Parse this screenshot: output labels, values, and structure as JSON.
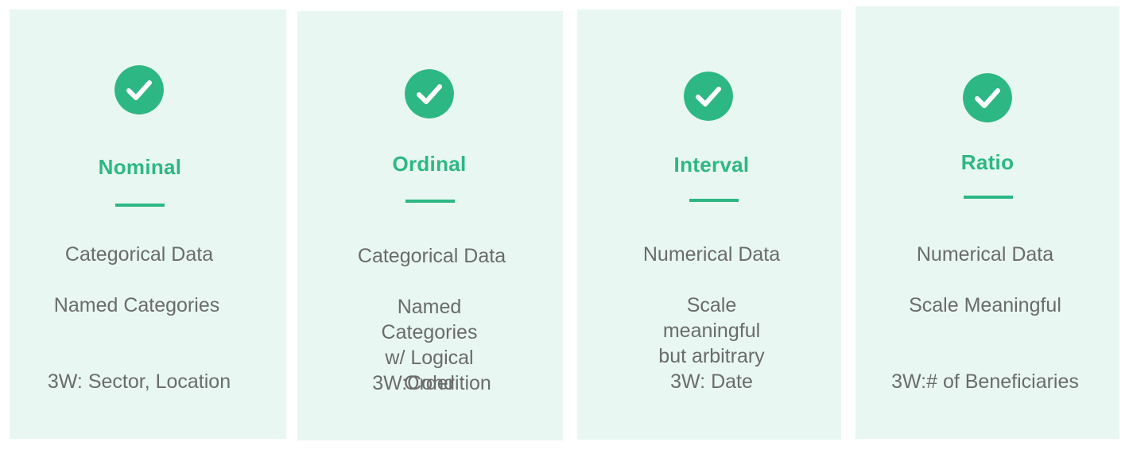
{
  "colors": {
    "accent": "#2db784",
    "card_background": "#e8f7f1",
    "body_text": "#6b6b6b"
  },
  "cards": [
    {
      "icon": "check-circle-icon",
      "title": "Nominal",
      "data_type": "Categorical Data",
      "description": "Named Categories",
      "example": "3W: Sector, Location"
    },
    {
      "icon": "check-circle-icon",
      "title": "Ordinal",
      "data_type": "Categorical Data",
      "description": "Named Categories\nw/ Logical Order",
      "example": "3W:Condition"
    },
    {
      "icon": "check-circle-icon",
      "title": "Interval",
      "data_type": "Numerical Data",
      "description": "Scale meaningful\nbut arbitrary",
      "example": "3W: Date"
    },
    {
      "icon": "check-circle-icon",
      "title": "Ratio",
      "data_type": "Numerical Data",
      "description": "Scale Meaningful",
      "example": "3W:# of Beneficiaries"
    }
  ]
}
